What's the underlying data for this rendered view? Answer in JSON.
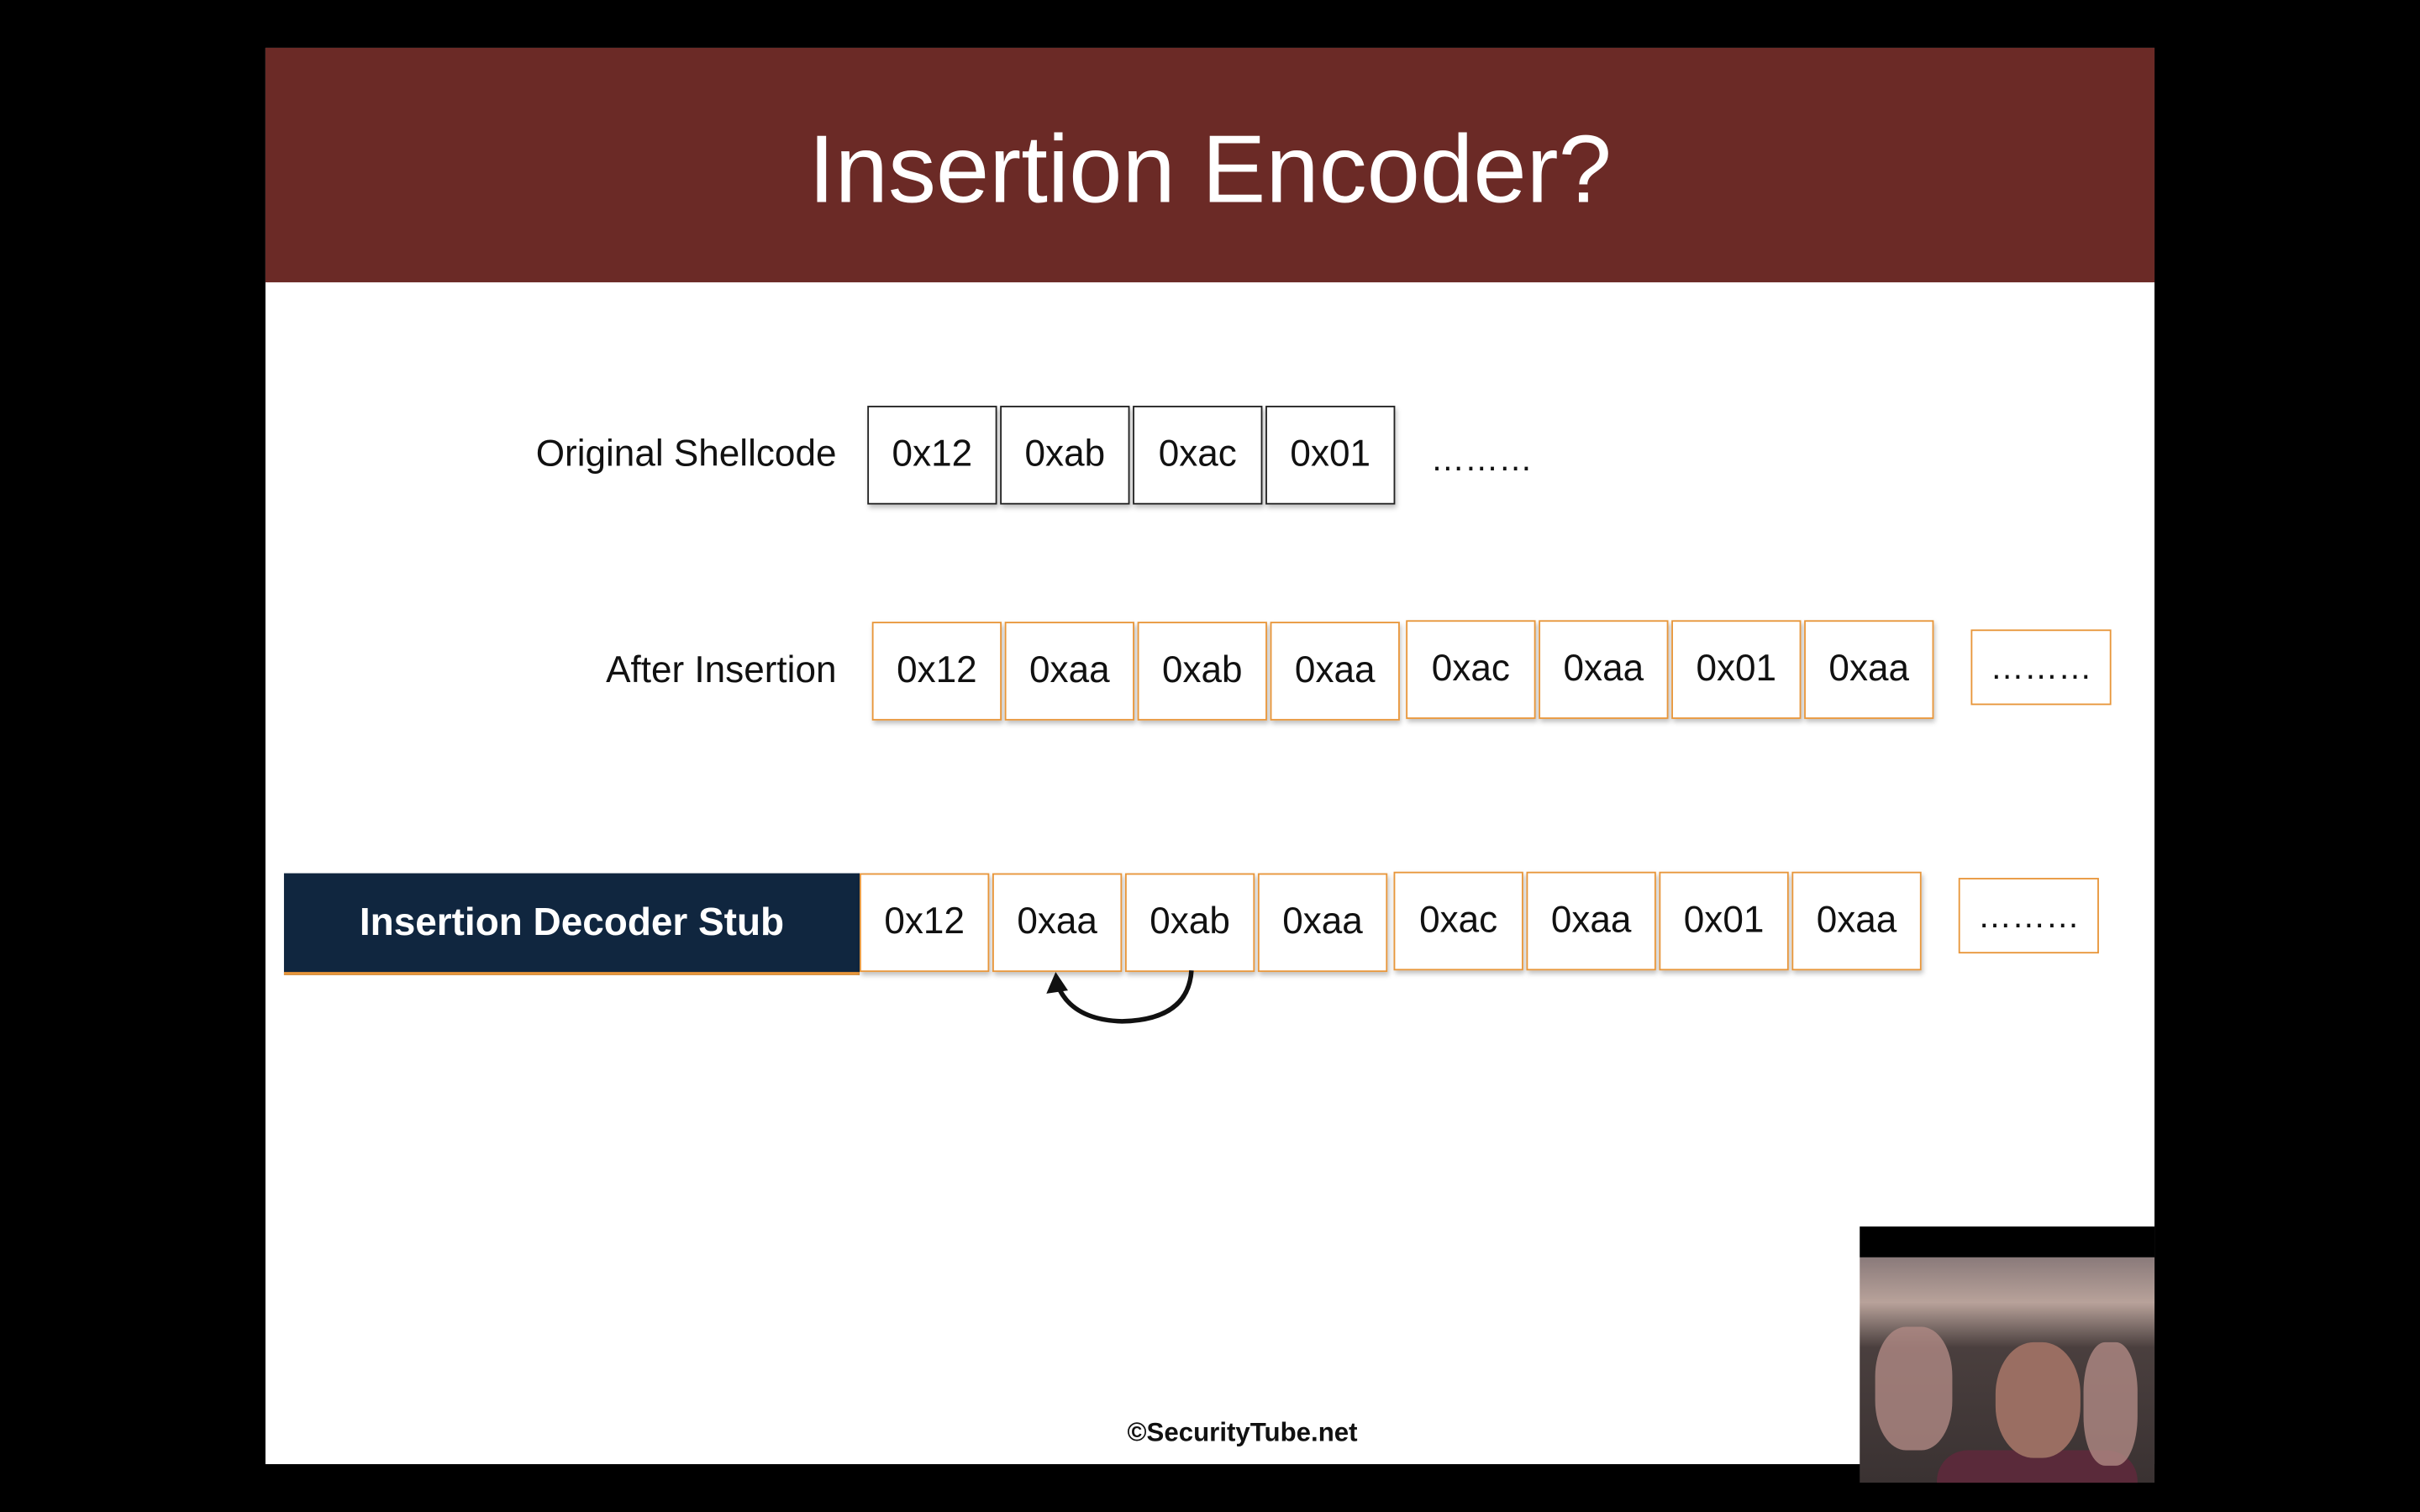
{
  "slide": {
    "title": "Insertion Encoder?",
    "rows": [
      {
        "label": "Original Shellcode",
        "cells": [
          "0x12",
          "0xab",
          "0xac",
          "0x01"
        ],
        "ellipsis": "………"
      },
      {
        "label": "After Insertion",
        "cells": [
          "0x12",
          "0xaa",
          "0xab",
          "0xaa",
          "0xac",
          "0xaa",
          "0x01",
          "0xaa"
        ],
        "ellipsis": "………"
      },
      {
        "label": "Insertion Decoder Stub",
        "cells": [
          "0x12",
          "0xaa",
          "0xab",
          "0xaa",
          "0xac",
          "0xaa",
          "0x01",
          "0xaa"
        ],
        "ellipsis": "………"
      }
    ],
    "footer": "©SecurityTube.net"
  },
  "colors": {
    "header": "#6b2a26",
    "stub": "#10263f",
    "accent": "#e8963a"
  }
}
